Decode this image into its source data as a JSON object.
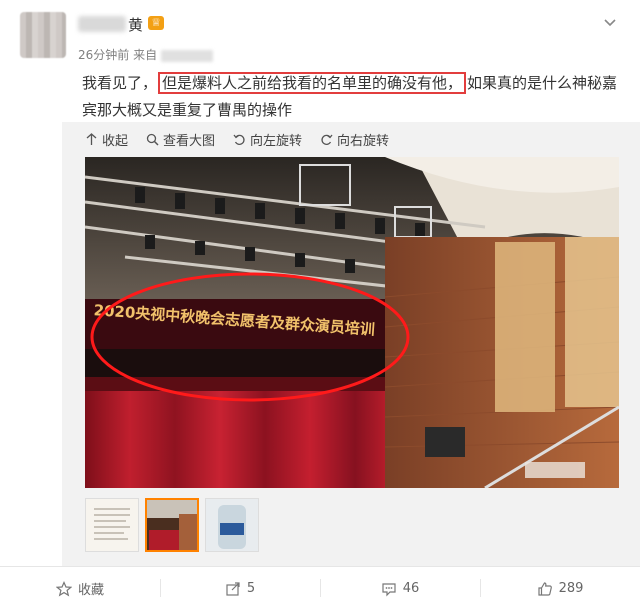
{
  "user": {
    "name": "黄",
    "vip_badge": "♕"
  },
  "meta": {
    "time": "26分钟前",
    "source_prefix": "来自"
  },
  "post": {
    "text_before": "我看见了，",
    "highlight": "但是爆料人之前给我看的名单里的确没有他，",
    "text_after": "如果真的是什么神秘嘉宾那大概又是重复了曹禺的操作"
  },
  "toolbar": {
    "collapse": "收起",
    "view_large": "查看大图",
    "rotate_left": "向左旋转",
    "rotate_right": "向右旋转"
  },
  "image": {
    "banner_text": "2020央视中秋晚会志愿者及群众演员培训"
  },
  "actions": {
    "favorite": "收藏",
    "repost_count": "5",
    "comment_count": "46",
    "like_count": "289"
  },
  "colors": {
    "highlight_border": "#e23d3d",
    "active_thumb": "#ff8200",
    "curtain": "#b01c2a"
  }
}
